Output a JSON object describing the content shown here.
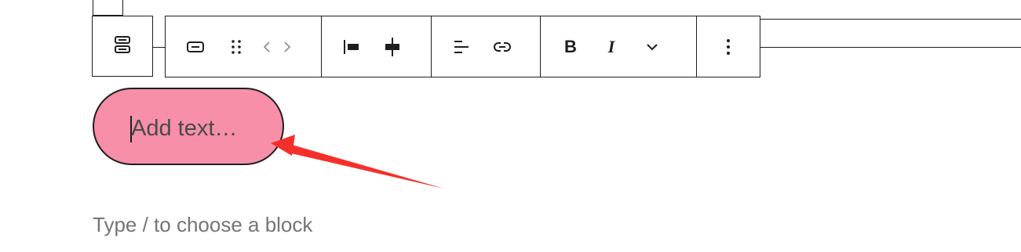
{
  "toolbar": {
    "groups": [
      {
        "name": "block",
        "buttons": [
          "button-block-icon",
          "drag-handle-icon",
          "move-arrows-icon"
        ]
      },
      {
        "name": "justify",
        "buttons": [
          "justify-left-icon",
          "justify-center-icon"
        ]
      },
      {
        "name": "text",
        "buttons": [
          "text-align-icon",
          "link-icon"
        ]
      },
      {
        "name": "format",
        "buttons": [
          "bold-icon",
          "italic-icon",
          "chevron-down-icon"
        ]
      },
      {
        "name": "options",
        "buttons": [
          "more-options-icon"
        ]
      }
    ],
    "bold_label": "B",
    "italic_label": "I"
  },
  "button_block": {
    "placeholder": "Add text…",
    "background_color": "#f78fa9"
  },
  "editor": {
    "appender_hint": "Type / to choose a block"
  },
  "annotation": {
    "arrow_color": "#f5302a"
  }
}
